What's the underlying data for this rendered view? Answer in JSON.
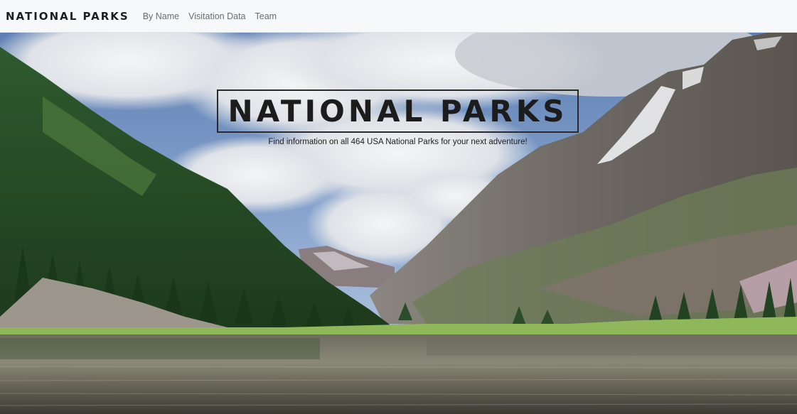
{
  "navbar": {
    "brand": "National Parks",
    "links": [
      {
        "label": "By Name"
      },
      {
        "label": "Visitation Data"
      },
      {
        "label": "Team"
      }
    ]
  },
  "hero": {
    "title": "National Parks",
    "subtitle": "Find information on all 464 USA National Parks for your next adventure!"
  },
  "colors": {
    "navbar_bg": "#f7f8fa",
    "title_text": "#1c1c1c",
    "nav_link": "#6b6b6b"
  }
}
